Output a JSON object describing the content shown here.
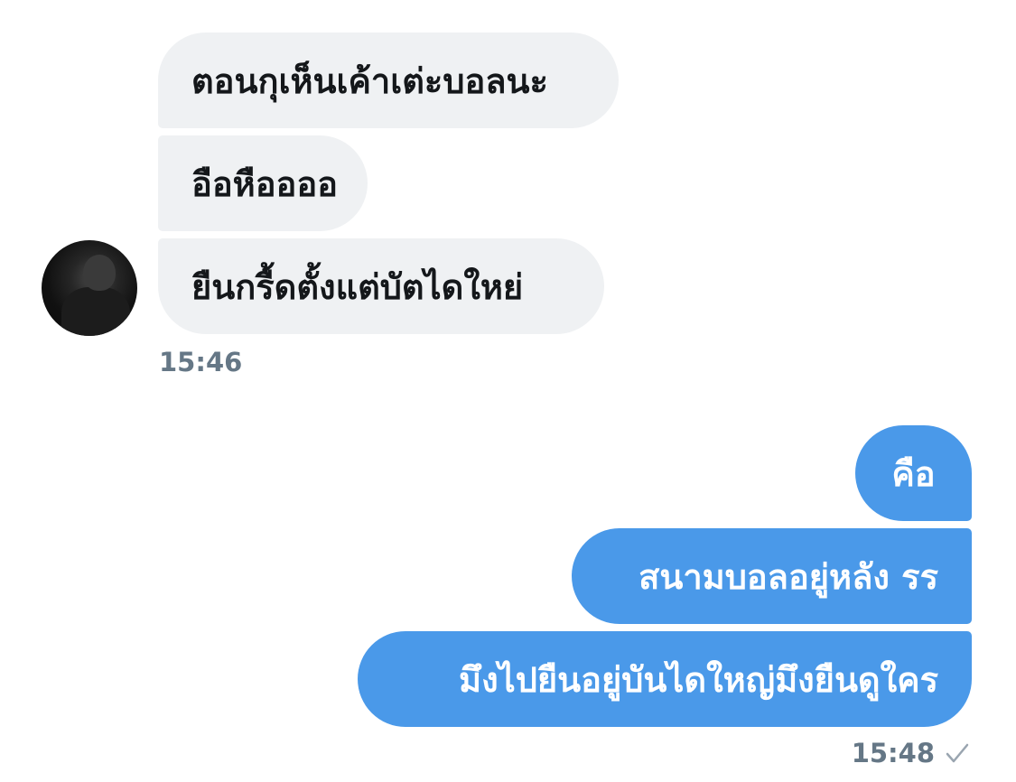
{
  "conversation": {
    "incoming": {
      "messages": [
        "ตอนกุเห็นเค้าเต่ะบอลนะ",
        "อือหืออออ",
        "ยืนกรื้ดตั้งแต่บัตไดใหย่"
      ],
      "time": "15:46"
    },
    "outgoing": {
      "messages": [
        "คือ",
        "สนามบอลอยู่หลัง รร",
        "มึงไปยืนอยู่บันไดใหญ่มึงยืนดูใคร"
      ],
      "time": "15:48",
      "status_icon": "check-icon"
    }
  },
  "colors": {
    "incoming_bubble": "#eff1f3",
    "outgoing_bubble": "#4a99e9",
    "timestamp": "#657786"
  }
}
